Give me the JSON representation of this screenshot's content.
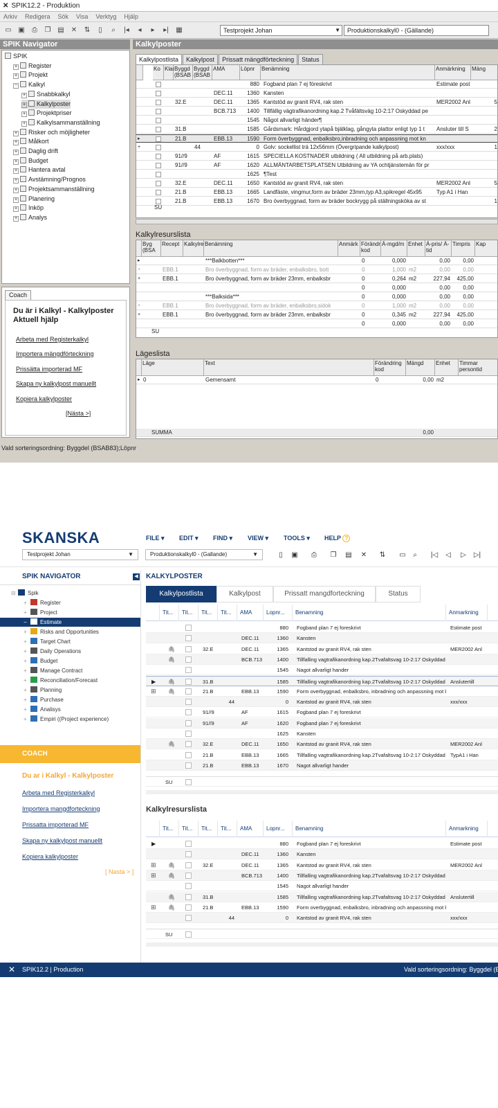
{
  "old": {
    "title": "SPIK12.2 - Produktion",
    "menu": [
      "Arkiv",
      "Redigera",
      "Sök",
      "Visa",
      "Verktyg",
      "Hjälp"
    ],
    "project": "Testprojekt Johan",
    "kalkyl": "Produktionskalkyl0 - (Gällande)",
    "nav_title": "SPIK Navigator",
    "main_title": "Kalkylposter",
    "tree": [
      {
        "label": "SPIK",
        "level": 0
      },
      {
        "label": "Register",
        "level": 1
      },
      {
        "label": "Projekt",
        "level": 1
      },
      {
        "label": "Kalkyl",
        "level": 1
      },
      {
        "label": "Snabbkalkyl",
        "level": 2
      },
      {
        "label": "Kalkylposter",
        "level": 2,
        "selected": true
      },
      {
        "label": "Projektpriser",
        "level": 2
      },
      {
        "label": "Kalkylsammanställning",
        "level": 2
      },
      {
        "label": "Risker och möjligheter",
        "level": 1
      },
      {
        "label": "Målkort",
        "level": 1
      },
      {
        "label": "Daglig drift",
        "level": 1
      },
      {
        "label": "Budget",
        "level": 1
      },
      {
        "label": "Hantera avtal",
        "level": 1
      },
      {
        "label": "Avstämning/Prognos",
        "level": 1
      },
      {
        "label": "Projektsammanställning",
        "level": 1
      },
      {
        "label": "Planering",
        "level": 1
      },
      {
        "label": "Inköp",
        "level": 1
      },
      {
        "label": "Analys",
        "level": 1
      }
    ],
    "coach": {
      "tab": "Coach",
      "heading1": "Du är i Kalkyl - Kalkylposter",
      "heading2": "Aktuell hjälp",
      "links": [
        "Arbeta med Registerkalkyl",
        "Importera mängdförteckning",
        "Prissätta importerad MF",
        "Skapa ny kalkylpost manuellt",
        "Kopiera kalkylposter"
      ],
      "next": "[Nästa >]"
    },
    "tabs": [
      "Kalkylpostlista",
      "Kalkylpost",
      "Prissatt mängdförteckning",
      "Status"
    ],
    "kp_headers": [
      "Ko",
      "Klar",
      "Byggd (BSAB",
      "Byggd (BSAB",
      "AMA",
      "Löpnr",
      "Benämning",
      "Anmärkning",
      "Mäng"
    ],
    "kp_rows": [
      {
        "b1": "",
        "b2": "",
        "ama": "",
        "lop": "880",
        "ben": "Fogband plan 7 ej föreskrivt",
        "anm": "Estimate post",
        "m": ""
      },
      {
        "b1": "",
        "b2": "",
        "ama": "DEC.11",
        "lop": "1360",
        "ben": "Kansten",
        "anm": "",
        "m": ""
      },
      {
        "b1": "32.E",
        "b2": "",
        "ama": "DEC.11",
        "lop": "1365",
        "ben": "Kantstöd av granit RV4, rak sten",
        "anm": "MER2002 Anl",
        "m": "5"
      },
      {
        "b1": "",
        "b2": "",
        "ama": "BCB.713",
        "lop": "1400",
        "ben": "Tillfällig vägtrafikanordning kap.2 Tvåfältsväg 10-2:17 Oskyddad pe",
        "anm": "",
        "m": ""
      },
      {
        "b1": "",
        "b2": "",
        "ama": "",
        "lop": "1545",
        "ben": "Något allvarligt händer¶",
        "anm": "",
        "m": ""
      },
      {
        "b1": "31.B",
        "b2": "",
        "ama": "",
        "lop": "1585",
        "ben": "Gårdsmark: Hårdgjord ytapå bjälklag, gångyta plattor enligt typ 1 t",
        "anm": "Ansluter till S",
        "m": "2"
      },
      {
        "b1": "21.B",
        "b2": "",
        "ama": "EBB.13",
        "lop": "1590",
        "ben": "Form överbyggnad, enbalksbro,inbradning och anpassning mot kn",
        "anm": "",
        "m": "",
        "sel": true
      },
      {
        "b1": "",
        "b2": "44",
        "ama": "",
        "lop": "0",
        "ben": "Golv: sockellist trä 12x56mm (Övergripande kalkylpost)",
        "anm": "xxx/xxx",
        "m": "1"
      },
      {
        "b1": "91//9",
        "b2": "",
        "ama": "AF",
        "lop": "1615",
        "ben": "SPECIELLA KOSTNADER utbildning ( All utbildning på arb.plats)",
        "anm": "",
        "m": ""
      },
      {
        "b1": "91//9",
        "b2": "",
        "ama": "AF",
        "lop": "1620",
        "ben": "ALLMÄNTARBETSPLATSEN Utbildning av YA ochtjänstemän för pr",
        "anm": "",
        "m": ""
      },
      {
        "b1": "",
        "b2": "",
        "ama": "",
        "lop": "1625",
        "ben": "¶Test",
        "anm": "",
        "m": ""
      },
      {
        "b1": "32.E",
        "b2": "",
        "ama": "DEC.11",
        "lop": "1650",
        "ben": "Kantstöd av granit RV4, rak sten",
        "anm": "MER2002 Anl",
        "m": "5"
      },
      {
        "b1": "21.B",
        "b2": "",
        "ama": "EBB.13",
        "lop": "1665",
        "ben": "Landfäste, vingmur,form av bräder 23mm,typ A3,spikregel 45x95",
        "anm": "Typ A1 i Han",
        "m": ""
      },
      {
        "b1": "21.B",
        "b2": "",
        "ama": "EBB.13",
        "lop": "1670",
        "ben": "Bro överbyggnad, form av bräder bockrygg på ställningsköka av st",
        "anm": "",
        "m": "1"
      }
    ],
    "kp_sum": "SU",
    "res_title": "Kalkylresurslista",
    "res_headers": [
      "Byg (BSA",
      "Recept",
      "Kalkylre",
      "Benämning",
      "Anmärk",
      "Förändr kod",
      "Á-mgd/m",
      "Enhet",
      "Á-pris/ Á-tid",
      "Timpris",
      "Kap"
    ],
    "res_rows": [
      {
        "rec": "",
        "ben": "***Balkbotten***",
        "fk": "0",
        "amgd": "0,000",
        "enh": "",
        "apris": "0,00",
        "tim": "0,00",
        "g": false
      },
      {
        "rec": "EBB.1",
        "ben": "Bro överbyggnad, form av bräder, enbalksbro, bott",
        "fk": "0",
        "amgd": "1,000",
        "enh": "m2",
        "apris": "0,00",
        "tim": "0,00",
        "g": true
      },
      {
        "rec": "EBB.1",
        "ben": "Bro överbyggnad, form av bräder 23mm, enbalksbr",
        "fk": "0",
        "amgd": "0,264",
        "enh": "m2",
        "apris": "227,94",
        "tim": "425,00",
        "g": false
      },
      {
        "rec": "",
        "ben": "",
        "fk": "0",
        "amgd": "0,000",
        "enh": "",
        "apris": "0,00",
        "tim": "0,00",
        "g": false
      },
      {
        "rec": "",
        "ben": "***Balksida***",
        "fk": "0",
        "amgd": "0,000",
        "enh": "",
        "apris": "0,00",
        "tim": "0,00",
        "g": false
      },
      {
        "rec": "EBB.1",
        "ben": "Bro överbyggnad, form av bräder, enbalksbro,sidok",
        "fk": "0",
        "amgd": "1,000",
        "enh": "m2",
        "apris": "0,00",
        "tim": "0,00",
        "g": true
      },
      {
        "rec": "EBB.1",
        "ben": "Bro överbyggnad, form av bräder 23mm, enbalksbr",
        "fk": "0",
        "amgd": "0,345",
        "enh": "m2",
        "apris": "227,94",
        "tim": "425,00",
        "g": false
      },
      {
        "rec": "",
        "ben": "",
        "fk": "0",
        "amgd": "0,000",
        "enh": "",
        "apris": "0,00",
        "tim": "0,00",
        "g": false
      }
    ],
    "res_sum": "SU",
    "lag_title": "Lägeslista",
    "lag_headers": [
      "Läge",
      "Text",
      "Förändring kod",
      "Mängd",
      "Enhet",
      "Timmar persontid"
    ],
    "lag_row": {
      "lage": "0",
      "text": "Gemensamt",
      "fk": "0",
      "mgd": "0,00",
      "enh": "m2"
    },
    "lag_sum": "SUMMA",
    "lag_sum_val": "0,00",
    "status": "Vald sorteringsordning: Byggdel (BSAB83);Löpnr"
  },
  "new": {
    "logo": "SKANSKA",
    "menu": [
      "FILE",
      "EDIT",
      "FIND",
      "VIEW",
      "TOOLS",
      "HELP"
    ],
    "help_icon": "?",
    "project": "Testprojekt Johan",
    "kalkyl": "Produktionskalkyl0 - (Gallande)",
    "nav_title": "SPIK NAVIGATOR",
    "main_title": "KALKYLPOSTER",
    "tree": [
      {
        "label": "Spik",
        "color": "#143c73"
      },
      {
        "label": "Register",
        "color": "#c0392b"
      },
      {
        "label": "Project",
        "color": "#555555"
      },
      {
        "label": "Estimate",
        "color": "#ffffff",
        "selected": true
      },
      {
        "label": "Risks and Opportunities",
        "color": "#e6a817"
      },
      {
        "label": "Target Chart",
        "color": "#2f6fb5"
      },
      {
        "label": "Daily Operations",
        "color": "#555555"
      },
      {
        "label": "Budget",
        "color": "#2f6fb5"
      },
      {
        "label": "Manage Contract",
        "color": "#555555"
      },
      {
        "label": "Reconciliation/Forecast",
        "color": "#2a9d4b"
      },
      {
        "label": "Planning",
        "color": "#555555"
      },
      {
        "label": "Purchase",
        "color": "#2f6fb5"
      },
      {
        "label": "Analisys",
        "color": "#2f6fb5"
      },
      {
        "label": "Empiri ((Project experience)",
        "color": "#2f6fb5"
      }
    ],
    "coach": {
      "title": "COACH",
      "heading": "Du ar i Kalkyl - Kalkylposter",
      "links": [
        "Arbeta med Registerkalkyl",
        "Importera mangdforteckning",
        "Prissatta importerad MF",
        "Skapa ny kalkylpost manuellt",
        "Kopiera kalkylposter"
      ],
      "next": "[ Nasta > ]"
    },
    "tabs": [
      "Kalkylpostlista",
      "Kalkylpost",
      "Prissatt mangdforteckning",
      "Status"
    ],
    "headers": [
      "Tit...",
      "Tit...",
      "Tit...",
      "Tit...",
      "AMA",
      "Lopnr...",
      "Benamning",
      "Anmarkning"
    ],
    "rows": [
      {
        "t3": "",
        "t4": "",
        "ama": "",
        "lop": "880",
        "ben": "Fogband plan 7 ej foreskrivt",
        "anm": "Estimate post",
        "clip": false,
        "ex": false
      },
      {
        "t3": "",
        "t4": "",
        "ama": "DEC.11",
        "lop": "1360",
        "ben": "Kansten",
        "anm": "",
        "clip": false,
        "ex": false
      },
      {
        "t3": "32.E",
        "t4": "",
        "ama": "DEC.11",
        "lop": "1365",
        "ben": "Kantstod av granit RV4, rak sten",
        "anm": "MER2002 Anl",
        "clip": true,
        "ex": false
      },
      {
        "t3": "",
        "t4": "",
        "ama": "BCB.713",
        "lop": "1400",
        "ben": "Tillfalling vagtrafikanordning kap.2Tvafaltsvag 10-2:17 Oskyddad",
        "anm": "",
        "clip": true,
        "ex": false
      },
      {
        "t3": "",
        "t4": "",
        "ama": "",
        "lop": "1545",
        "ben": "Nagot allvarligt hander",
        "anm": "",
        "clip": false,
        "ex": false
      },
      {
        "t3": "31.B",
        "t4": "",
        "ama": "",
        "lop": "1585",
        "ben": "Tillfalling vagtrafikanordning kap.2Tvafaltsvag 10-2:17 Oskyddad",
        "anm": "Anslutertill",
        "clip": true,
        "ex": false,
        "arrow": true,
        "hl": true
      },
      {
        "t3": "21.B",
        "t4": "",
        "ama": "EBB.13",
        "lop": "1590",
        "ben": "Form overbyggnad, enbalksbro, inbradning och anpassning mot kn",
        "anm": "",
        "clip": true,
        "ex": true
      },
      {
        "t3": "",
        "t4": "44",
        "ama": "",
        "lop": "0",
        "ben": "Kantstod av granit RV4, rak sten",
        "anm": "xxx/xxx",
        "clip": false,
        "ex": false
      },
      {
        "t3": "91//9",
        "t4": "",
        "ama": "AF",
        "lop": "1615",
        "ben": "Fogband plan 7 ej foreskrivt",
        "anm": "",
        "clip": false,
        "ex": false
      },
      {
        "t3": "91//9",
        "t4": "",
        "ama": "AF",
        "lop": "1620",
        "ben": "Fogband plan 7 ej foreskrivt",
        "anm": "",
        "clip": false,
        "ex": false
      },
      {
        "t3": "",
        "t4": "",
        "ama": "",
        "lop": "1625",
        "ben": "Kansten",
        "anm": "",
        "clip": false,
        "ex": false
      },
      {
        "t3": "32.E",
        "t4": "",
        "ama": "DEC.11",
        "lop": "1650",
        "ben": "Kantstod av granit RV4, rak sten",
        "anm": "MER2002 Anl",
        "clip": true,
        "ex": false
      },
      {
        "t3": "21.B",
        "t4": "",
        "ama": "EBB.13",
        "lop": "1665",
        "ben": "Tillfalling vagtrafikanordning kap.2Tvafaltsvag 10-2:17 Oskyddad",
        "anm": "TypA1 i Han",
        "clip": false,
        "ex": false
      },
      {
        "t3": "21.B",
        "t4": "",
        "ama": "EBB.13",
        "lop": "1670",
        "ben": "Nagot allvarligt hander",
        "anm": "",
        "clip": false,
        "ex": false
      }
    ],
    "sum": "SU",
    "res_title": "Kalkylresurslista",
    "res_rows": [
      {
        "t3": "",
        "t4": "",
        "ama": "",
        "lop": "880",
        "ben": "Fogband plan 7 ej foreskrivt",
        "anm": "Estimate post",
        "clip": false,
        "ex": false,
        "arrow": true
      },
      {
        "t3": "",
        "t4": "",
        "ama": "DEC.11",
        "lop": "1360",
        "ben": "Kansten",
        "anm": "",
        "clip": false,
        "ex": false
      },
      {
        "t3": "32.E",
        "t4": "",
        "ama": "DEC.11",
        "lop": "1365",
        "ben": "Kantstod av granit RV4, rak sten",
        "anm": "MER2002 Anl",
        "clip": true,
        "ex": true
      },
      {
        "t3": "",
        "t4": "",
        "ama": "BCB.713",
        "lop": "1400",
        "ben": "Tillfalling vagtrafikanordning kap.2Tvafaltsvag 10-2:17 Oskyddad",
        "anm": "",
        "clip": true,
        "ex": true
      },
      {
        "t3": "",
        "t4": "",
        "ama": "",
        "lop": "1545",
        "ben": "Nagot allvarligt hander",
        "anm": "",
        "clip": false,
        "ex": false
      },
      {
        "t3": "31.B",
        "t4": "",
        "ama": "",
        "lop": "1585",
        "ben": "Tillfalling vagtrafikanordning kap.2Tvafaltsvag 10-2:17 Oskyddad",
        "anm": "Anslutertill",
        "clip": true,
        "ex": false
      },
      {
        "t3": "21.B",
        "t4": "",
        "ama": "EBB.13",
        "lop": "1590",
        "ben": "Form overbyggnad, enbalksbro, inbradning och anpassning mot kn",
        "anm": "",
        "clip": true,
        "ex": true
      },
      {
        "t3": "",
        "t4": "44",
        "ama": "",
        "lop": "0",
        "ben": "Kantstod av granit RV4, rak sten",
        "anm": "xxx/xxx",
        "clip": false,
        "ex": false
      }
    ],
    "res_sum": "SU",
    "footer_left": "SPIK12.2 | Production",
    "footer_right": "Vald sorteringsordning: Byggdel (B",
    "accent": "#143c73",
    "coach_color": "#f7b731"
  }
}
